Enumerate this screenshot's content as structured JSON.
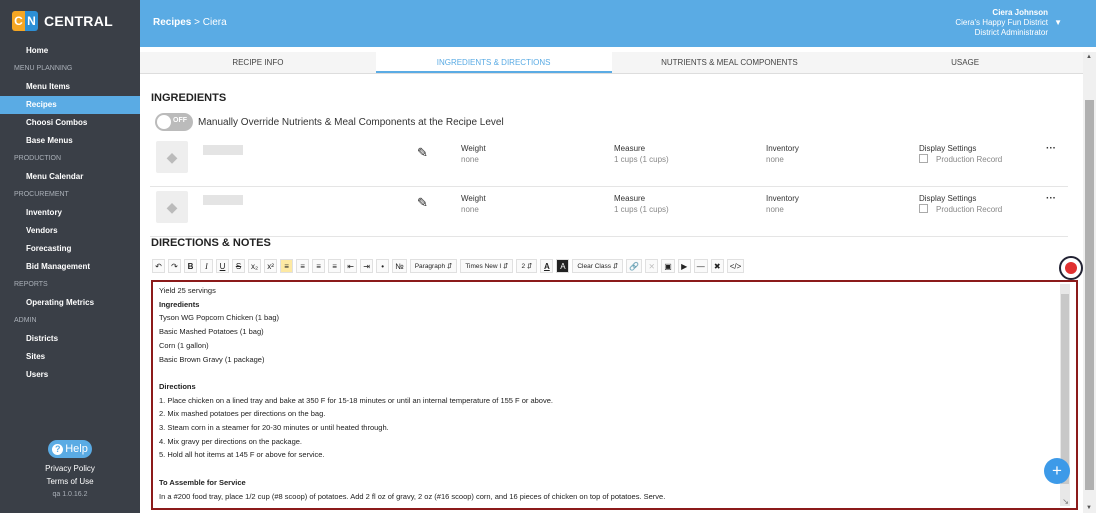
{
  "brand": {
    "badge_c": "C",
    "badge_n": "N",
    "name": "CENTRAL"
  },
  "sidebar": {
    "home": "Home",
    "sections": [
      {
        "title": "MENU PLANNING",
        "items": [
          "Menu Items",
          "Recipes",
          "Choosi Combos",
          "Base Menus"
        ]
      },
      {
        "title": "PRODUCTION",
        "items": [
          "Menu Calendar"
        ]
      },
      {
        "title": "PROCUREMENT",
        "items": [
          "Inventory",
          "Vendors",
          "Forecasting",
          "Bid Management"
        ]
      },
      {
        "title": "REPORTS",
        "items": [
          "Operating Metrics"
        ]
      },
      {
        "title": "ADMIN",
        "items": [
          "Districts",
          "Sites",
          "Users"
        ]
      }
    ],
    "active_item": "Recipes",
    "help": "Help",
    "privacy": "Privacy Policy",
    "terms": "Terms of Use",
    "version": "qa 1.0.16.2"
  },
  "header": {
    "breadcrumb_root": "Recipes",
    "breadcrumb_sep": ">",
    "breadcrumb_leaf": "Ciera",
    "user_name": "Ciera Johnson",
    "district": "Ciera's Happy Fun District",
    "role": "District Administrator"
  },
  "tabs": [
    "RECIPE INFO",
    "INGREDIENTS & DIRECTIONS",
    "NUTRIENTS & MEAL COMPONENTS",
    "USAGE"
  ],
  "active_tab": 1,
  "ingredients": {
    "heading": "INGREDIENTS",
    "toggle_label": "OFF",
    "override_label": "Manually Override Nutrients & Meal Components at the Recipe Level",
    "rows": [
      {
        "weight_label": "Weight",
        "weight": "none",
        "measure_label": "Measure",
        "measure": "1 cups (1 cups)",
        "inventory_label": "Inventory",
        "inventory": "none",
        "display_label": "Display Settings",
        "display_option": "Production Record"
      },
      {
        "weight_label": "Weight",
        "weight": "none",
        "measure_label": "Measure",
        "measure": "1 cups (1 cups)",
        "inventory_label": "Inventory",
        "inventory": "none",
        "display_label": "Display Settings",
        "display_option": "Production Record"
      }
    ]
  },
  "directions": {
    "heading": "DIRECTIONS & NOTES",
    "toolbar": {
      "paragraph": "Paragraph",
      "font": "Times New I",
      "size": "2",
      "clear_class": "Clear Class"
    },
    "lines": [
      {
        "text": "Yield 25 servings",
        "bold": false
      },
      {
        "text": "Ingredients",
        "bold": true
      },
      {
        "text": "Tyson WG Popcorn Chicken (1 bag)",
        "bold": false
      },
      {
        "text": "Basic Mashed Potatoes (1 bag)",
        "bold": false
      },
      {
        "text": "Corn (1 gallon)",
        "bold": false
      },
      {
        "text": "Basic Brown Gravy (1 package)",
        "bold": false
      },
      {
        "text": "",
        "bold": false
      },
      {
        "text": "Directions",
        "bold": true
      },
      {
        "text": "1. Place chicken on a lined tray and bake at 350 F for 15-18 minutes or until an internal temperature of 155 F or above.",
        "bold": false
      },
      {
        "text": "2. Mix mashed potatoes per directions on the bag.",
        "bold": false
      },
      {
        "text": "3. Steam corn in a steamer for 20-30 minutes or until heated through.",
        "bold": false
      },
      {
        "text": "4. Mix gravy per directions on the package.",
        "bold": false
      },
      {
        "text": "5. Hold all hot items at 145 F or above for service.",
        "bold": false
      },
      {
        "text": "",
        "bold": false
      },
      {
        "text": "To Assemble for Service",
        "bold": true
      },
      {
        "text": "In a #200 food tray, place 1/2 cup (#8 scoop) of potatoes. Add 2 fl oz of gravy, 2 oz (#16 scoop) corn,  and 16 pieces of chicken on top of potatoes. Serve.",
        "bold": false
      }
    ]
  },
  "fab_label": "+"
}
